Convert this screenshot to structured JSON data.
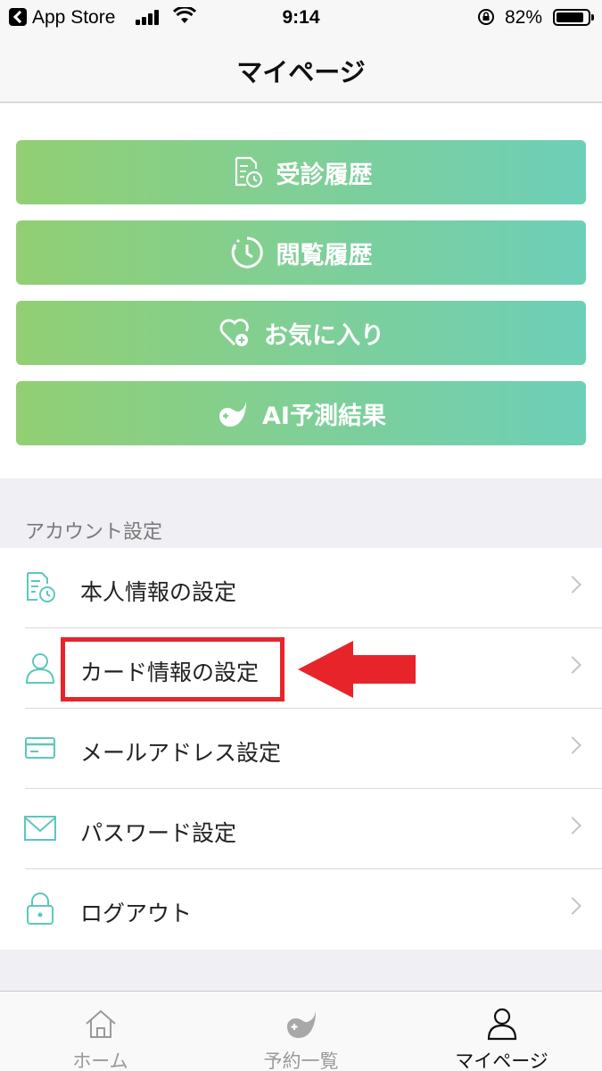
{
  "status_bar": {
    "back_app": "App Store",
    "time": "9:14",
    "battery": "82%"
  },
  "nav": {
    "title": "マイページ"
  },
  "menu_buttons": [
    {
      "label": "受診履歴",
      "icon": "document-clock-icon"
    },
    {
      "label": "閲覧履歴",
      "icon": "clock-icon"
    },
    {
      "label": "お気に入り",
      "icon": "heart-plus-icon"
    },
    {
      "label": "AI予測結果",
      "icon": "ai-leaf-icon"
    }
  ],
  "account_section": {
    "header": "アカウント設定",
    "items": [
      {
        "label": "本人情報の設定",
        "icon": "document-clock-icon"
      },
      {
        "label": "カード情報の設定",
        "icon": "person-icon"
      },
      {
        "label": "メールアドレス設定",
        "icon": "card-icon"
      },
      {
        "label": "パスワード設定",
        "icon": "envelope-icon"
      },
      {
        "label": "ログアウト",
        "icon": "lock-icon"
      }
    ]
  },
  "annotation": {
    "highlight_color": "#e8242b",
    "highlighted_item": "カード情報の設定"
  },
  "tab_bar": {
    "tabs": [
      {
        "label": "ホーム",
        "icon": "home-icon",
        "active": false
      },
      {
        "label": "予約一覧",
        "icon": "ai-leaf-icon",
        "active": false
      },
      {
        "label": "マイページ",
        "icon": "person-icon",
        "active": true
      }
    ]
  },
  "colors": {
    "gradient_start": "#92cf73",
    "gradient_end": "#6dcfb8",
    "icon_teal": "#5cc8bc"
  }
}
